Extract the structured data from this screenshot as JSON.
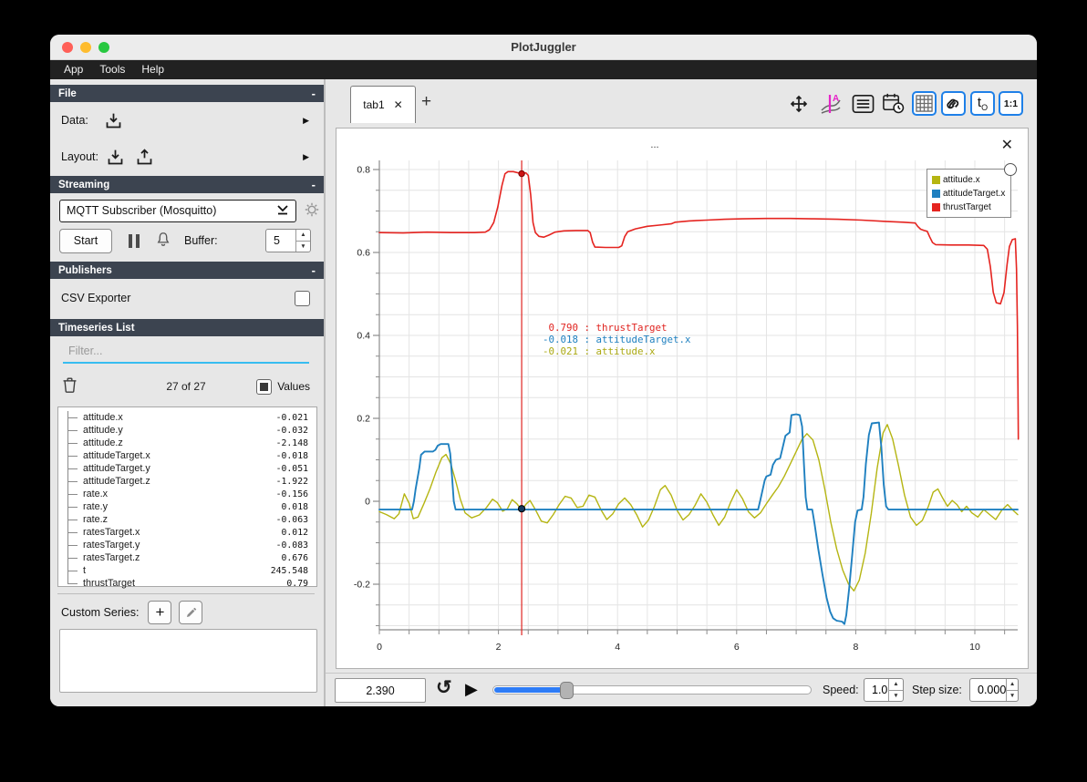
{
  "window": {
    "title": "PlotJuggler"
  },
  "menu": {
    "items": [
      "App",
      "Tools",
      "Help"
    ]
  },
  "glyphs": {
    "minus": "-",
    "chevron_right": "▶",
    "up": "▲",
    "down": "▼",
    "close": "✕",
    "plus": "+",
    "play": "▶",
    "loop": "↺",
    "ellipsis": "..."
  },
  "sidebar": {
    "file": {
      "title": "File",
      "data_label": "Data:",
      "layout_label": "Layout:"
    },
    "streaming": {
      "title": "Streaming",
      "source": "MQTT Subscriber (Mosquitto)",
      "start_label": "Start",
      "buffer_label": "Buffer:",
      "buffer_value": "5"
    },
    "publishers": {
      "title": "Publishers",
      "csv_label": "CSV Exporter",
      "csv_checked": false
    },
    "timeseries": {
      "title": "Timeseries List",
      "filter_placeholder": "Filter...",
      "count": "27 of 27",
      "values_label": "Values",
      "values_state": "partial",
      "items": [
        {
          "name": "attitude.x",
          "value": "-0.021"
        },
        {
          "name": "attitude.y",
          "value": "-0.032"
        },
        {
          "name": "attitude.z",
          "value": "-2.148"
        },
        {
          "name": "attitudeTarget.x",
          "value": "-0.018"
        },
        {
          "name": "attitudeTarget.y",
          "value": "-0.051"
        },
        {
          "name": "attitudeTarget.z",
          "value": "-1.922"
        },
        {
          "name": "rate.x",
          "value": "-0.156"
        },
        {
          "name": "rate.y",
          "value": "0.018"
        },
        {
          "name": "rate.z",
          "value": "-0.063"
        },
        {
          "name": "ratesTarget.x",
          "value": "0.012"
        },
        {
          "name": "ratesTarget.y",
          "value": "-0.083"
        },
        {
          "name": "ratesTarget.z",
          "value": "0.676"
        },
        {
          "name": "t",
          "value": "245.548"
        },
        {
          "name": "thrustTarget",
          "value": "0.79"
        }
      ],
      "custom_series_label": "Custom Series:"
    }
  },
  "tabs": {
    "active": "tab1"
  },
  "toolbar": {
    "t0_main": "t",
    "t0_sub": "O",
    "ratio": "1:1",
    "accent_blue": "#1e80e8"
  },
  "plot": {
    "title": "..."
  },
  "tracker": {
    "time_value": "2.390",
    "readings": [
      {
        "value": " 0.790",
        "sep": " : ",
        "name": "thrustTarget",
        "color": "#e02420"
      },
      {
        "value": "-0.018",
        "sep": " : ",
        "name": "attitudeTarget.x",
        "color": "#1f80c0"
      },
      {
        "value": "-0.021",
        "sep": " : ",
        "name": "attitude.x",
        "color": "#aaa811"
      }
    ]
  },
  "playback": {
    "speed_label": "Speed:",
    "speed_value": "1.0",
    "step_label": "Step size:",
    "step_value": "0.000",
    "slider_fraction": 0.23
  },
  "chart_data": {
    "type": "line",
    "title": "...",
    "xlabel": "",
    "ylabel": "",
    "xlim": [
      0,
      10.72
    ],
    "ylim": [
      -0.33,
      0.82
    ],
    "grid": true,
    "legend_position": "top-right",
    "x_tick_labels": [
      "0",
      "2",
      "4",
      "6",
      "8",
      "10"
    ],
    "x_tick_values": [
      0,
      2,
      4,
      6,
      8,
      10
    ],
    "y_tick_labels": [
      "0.8",
      "0.6",
      "0.4",
      "0.2",
      "0",
      "-0.2"
    ],
    "y_tick_values": [
      0.8,
      0.6,
      0.4,
      0.2,
      0,
      -0.2
    ],
    "tracker": {
      "x": 2.39,
      "dots": [
        {
          "x": 2.39,
          "y": 0.79,
          "color": "#cc1414",
          "edge": "#7a0000",
          "r": 3.2
        },
        {
          "x": 2.39,
          "y": -0.018,
          "color": "#123a5e",
          "edge": "#000000",
          "r": 3.6
        }
      ]
    },
    "series": [
      {
        "name": "attitude.x",
        "color": "#b5b512",
        "width": 1.4,
        "points": [
          [
            0,
            -0.025
          ],
          [
            0.12,
            -0.032
          ],
          [
            0.25,
            -0.042
          ],
          [
            0.33,
            -0.03
          ],
          [
            0.42,
            0.018
          ],
          [
            0.5,
            -0.005
          ],
          [
            0.57,
            -0.042
          ],
          [
            0.65,
            -0.038
          ],
          [
            0.75,
            -0.005
          ],
          [
            0.85,
            0.03
          ],
          [
            0.95,
            0.07
          ],
          [
            1.05,
            0.105
          ],
          [
            1.12,
            0.113
          ],
          [
            1.2,
            0.09
          ],
          [
            1.28,
            0.05
          ],
          [
            1.36,
            0.005
          ],
          [
            1.44,
            -0.028
          ],
          [
            1.55,
            -0.04
          ],
          [
            1.68,
            -0.033
          ],
          [
            1.8,
            -0.015
          ],
          [
            1.9,
            0.005
          ],
          [
            1.98,
            -0.003
          ],
          [
            2.07,
            -0.024
          ],
          [
            2.15,
            -0.018
          ],
          [
            2.23,
            0.004
          ],
          [
            2.31,
            -0.006
          ],
          [
            2.39,
            -0.021
          ],
          [
            2.47,
            -0.006
          ],
          [
            2.53,
            0.002
          ],
          [
            2.62,
            -0.02
          ],
          [
            2.72,
            -0.048
          ],
          [
            2.82,
            -0.052
          ],
          [
            2.92,
            -0.032
          ],
          [
            3.02,
            -0.008
          ],
          [
            3.12,
            0.012
          ],
          [
            3.22,
            0.008
          ],
          [
            3.32,
            -0.015
          ],
          [
            3.42,
            -0.012
          ],
          [
            3.52,
            0.015
          ],
          [
            3.62,
            0.01
          ],
          [
            3.72,
            -0.02
          ],
          [
            3.82,
            -0.044
          ],
          [
            3.92,
            -0.03
          ],
          [
            4.02,
            -0.006
          ],
          [
            4.12,
            0.008
          ],
          [
            4.22,
            -0.008
          ],
          [
            4.32,
            -0.032
          ],
          [
            4.42,
            -0.062
          ],
          [
            4.52,
            -0.045
          ],
          [
            4.62,
            -0.012
          ],
          [
            4.72,
            0.028
          ],
          [
            4.8,
            0.038
          ],
          [
            4.9,
            0.015
          ],
          [
            5.0,
            -0.022
          ],
          [
            5.1,
            -0.045
          ],
          [
            5.2,
            -0.032
          ],
          [
            5.3,
            -0.01
          ],
          [
            5.4,
            0.018
          ],
          [
            5.5,
            -0.002
          ],
          [
            5.6,
            -0.032
          ],
          [
            5.7,
            -0.058
          ],
          [
            5.8,
            -0.038
          ],
          [
            5.9,
            -0.002
          ],
          [
            6.0,
            0.028
          ],
          [
            6.1,
            0.006
          ],
          [
            6.2,
            -0.026
          ],
          [
            6.3,
            -0.04
          ],
          [
            6.4,
            -0.028
          ],
          [
            6.5,
            -0.006
          ],
          [
            6.6,
            0.015
          ],
          [
            6.7,
            0.035
          ],
          [
            6.8,
            0.06
          ],
          [
            6.9,
            0.09
          ],
          [
            7.0,
            0.12
          ],
          [
            7.1,
            0.15
          ],
          [
            7.18,
            0.163
          ],
          [
            7.28,
            0.148
          ],
          [
            7.38,
            0.1
          ],
          [
            7.48,
            0.03
          ],
          [
            7.58,
            -0.05
          ],
          [
            7.68,
            -0.115
          ],
          [
            7.78,
            -0.165
          ],
          [
            7.88,
            -0.2
          ],
          [
            7.97,
            -0.216
          ],
          [
            8.06,
            -0.19
          ],
          [
            8.16,
            -0.125
          ],
          [
            8.26,
            -0.03
          ],
          [
            8.36,
            0.08
          ],
          [
            8.46,
            0.165
          ],
          [
            8.53,
            0.185
          ],
          [
            8.62,
            0.15
          ],
          [
            8.72,
            0.085
          ],
          [
            8.82,
            0.015
          ],
          [
            8.92,
            -0.038
          ],
          [
            9.02,
            -0.058
          ],
          [
            9.12,
            -0.046
          ],
          [
            9.22,
            -0.012
          ],
          [
            9.3,
            0.022
          ],
          [
            9.38,
            0.03
          ],
          [
            9.46,
            0.008
          ],
          [
            9.54,
            -0.012
          ],
          [
            9.62,
            0.002
          ],
          [
            9.7,
            -0.008
          ],
          [
            9.78,
            -0.025
          ],
          [
            9.86,
            -0.012
          ],
          [
            9.95,
            -0.028
          ],
          [
            10.05,
            -0.038
          ],
          [
            10.15,
            -0.02
          ],
          [
            10.25,
            -0.032
          ],
          [
            10.35,
            -0.044
          ],
          [
            10.45,
            -0.022
          ],
          [
            10.55,
            -0.008
          ],
          [
            10.63,
            -0.02
          ],
          [
            10.72,
            -0.032
          ]
        ]
      },
      {
        "name": "attitudeTarget.x",
        "color": "#1f80c0",
        "width": 1.9,
        "points": [
          [
            0,
            -0.02
          ],
          [
            0.55,
            -0.02
          ],
          [
            0.58,
            0.0
          ],
          [
            0.61,
            0.03
          ],
          [
            0.64,
            0.055
          ],
          [
            0.67,
            0.08
          ],
          [
            0.7,
            0.112
          ],
          [
            0.76,
            0.12
          ],
          [
            0.9,
            0.12
          ],
          [
            0.94,
            0.124
          ],
          [
            0.98,
            0.134
          ],
          [
            1.03,
            0.138
          ],
          [
            1.16,
            0.138
          ],
          [
            1.19,
            0.115
          ],
          [
            1.22,
            0.06
          ],
          [
            1.25,
            0.0
          ],
          [
            1.28,
            -0.02
          ],
          [
            6.36,
            -0.02
          ],
          [
            6.4,
            0.004
          ],
          [
            6.44,
            0.03
          ],
          [
            6.47,
            0.05
          ],
          [
            6.5,
            0.06
          ],
          [
            6.57,
            0.064
          ],
          [
            6.61,
            0.088
          ],
          [
            6.66,
            0.1
          ],
          [
            6.73,
            0.104
          ],
          [
            6.77,
            0.128
          ],
          [
            6.82,
            0.158
          ],
          [
            6.89,
            0.166
          ],
          [
            6.92,
            0.208
          ],
          [
            7.0,
            0.21
          ],
          [
            7.06,
            0.208
          ],
          [
            7.1,
            0.18
          ],
          [
            7.13,
            0.09
          ],
          [
            7.16,
            0.01
          ],
          [
            7.19,
            -0.02
          ],
          [
            7.27,
            -0.02
          ],
          [
            7.31,
            -0.055
          ],
          [
            7.37,
            -0.115
          ],
          [
            7.44,
            -0.175
          ],
          [
            7.51,
            -0.232
          ],
          [
            7.57,
            -0.266
          ],
          [
            7.62,
            -0.282
          ],
          [
            7.68,
            -0.288
          ],
          [
            7.77,
            -0.29
          ],
          [
            7.81,
            -0.296
          ],
          [
            7.84,
            -0.275
          ],
          [
            7.89,
            -0.21
          ],
          [
            7.94,
            -0.13
          ],
          [
            7.99,
            -0.05
          ],
          [
            8.03,
            -0.022
          ],
          [
            8.1,
            -0.02
          ],
          [
            8.13,
            0.01
          ],
          [
            8.17,
            0.09
          ],
          [
            8.22,
            0.16
          ],
          [
            8.27,
            0.188
          ],
          [
            8.39,
            0.19
          ],
          [
            8.43,
            0.13
          ],
          [
            8.47,
            0.04
          ],
          [
            8.51,
            -0.012
          ],
          [
            8.55,
            -0.02
          ],
          [
            10.72,
            -0.02
          ]
        ]
      },
      {
        "name": "thrustTarget",
        "color": "#e52420",
        "width": 1.6,
        "points": [
          [
            0,
            0.648
          ],
          [
            0.4,
            0.647
          ],
          [
            0.8,
            0.649
          ],
          [
            1.2,
            0.648
          ],
          [
            1.6,
            0.648
          ],
          [
            1.78,
            0.649
          ],
          [
            1.85,
            0.655
          ],
          [
            1.92,
            0.672
          ],
          [
            1.99,
            0.71
          ],
          [
            2.06,
            0.762
          ],
          [
            2.11,
            0.79
          ],
          [
            2.16,
            0.795
          ],
          [
            2.25,
            0.795
          ],
          [
            2.33,
            0.792
          ],
          [
            2.39,
            0.79
          ],
          [
            2.46,
            0.792
          ],
          [
            2.5,
            0.786
          ],
          [
            2.54,
            0.74
          ],
          [
            2.58,
            0.672
          ],
          [
            2.62,
            0.648
          ],
          [
            2.68,
            0.639
          ],
          [
            2.76,
            0.637
          ],
          [
            2.85,
            0.642
          ],
          [
            2.95,
            0.649
          ],
          [
            3.1,
            0.652
          ],
          [
            3.3,
            0.653
          ],
          [
            3.5,
            0.653
          ],
          [
            3.54,
            0.648
          ],
          [
            3.58,
            0.625
          ],
          [
            3.62,
            0.613
          ],
          [
            3.8,
            0.612
          ],
          [
            4.02,
            0.612
          ],
          [
            4.07,
            0.616
          ],
          [
            4.12,
            0.638
          ],
          [
            4.17,
            0.65
          ],
          [
            4.3,
            0.657
          ],
          [
            4.5,
            0.663
          ],
          [
            4.7,
            0.666
          ],
          [
            4.9,
            0.669
          ],
          [
            4.97,
            0.673
          ],
          [
            5.2,
            0.676
          ],
          [
            5.5,
            0.678
          ],
          [
            5.8,
            0.68
          ],
          [
            6.1,
            0.681
          ],
          [
            6.5,
            0.682
          ],
          [
            6.9,
            0.682
          ],
          [
            7.3,
            0.681
          ],
          [
            7.7,
            0.68
          ],
          [
            8.1,
            0.678
          ],
          [
            8.5,
            0.675
          ],
          [
            8.8,
            0.673
          ],
          [
            9.0,
            0.671
          ],
          [
            9.04,
            0.663
          ],
          [
            9.09,
            0.656
          ],
          [
            9.15,
            0.653
          ],
          [
            9.2,
            0.651
          ],
          [
            9.24,
            0.638
          ],
          [
            9.29,
            0.624
          ],
          [
            9.34,
            0.619
          ],
          [
            9.6,
            0.618
          ],
          [
            9.9,
            0.618
          ],
          [
            10.15,
            0.617
          ],
          [
            10.21,
            0.608
          ],
          [
            10.26,
            0.566
          ],
          [
            10.31,
            0.504
          ],
          [
            10.36,
            0.479
          ],
          [
            10.43,
            0.476
          ],
          [
            10.49,
            0.503
          ],
          [
            10.54,
            0.57
          ],
          [
            10.58,
            0.614
          ],
          [
            10.63,
            0.631
          ],
          [
            10.68,
            0.633
          ],
          [
            10.7,
            0.56
          ],
          [
            10.715,
            0.42
          ],
          [
            10.725,
            0.27
          ],
          [
            10.73,
            0.15
          ]
        ]
      }
    ]
  }
}
